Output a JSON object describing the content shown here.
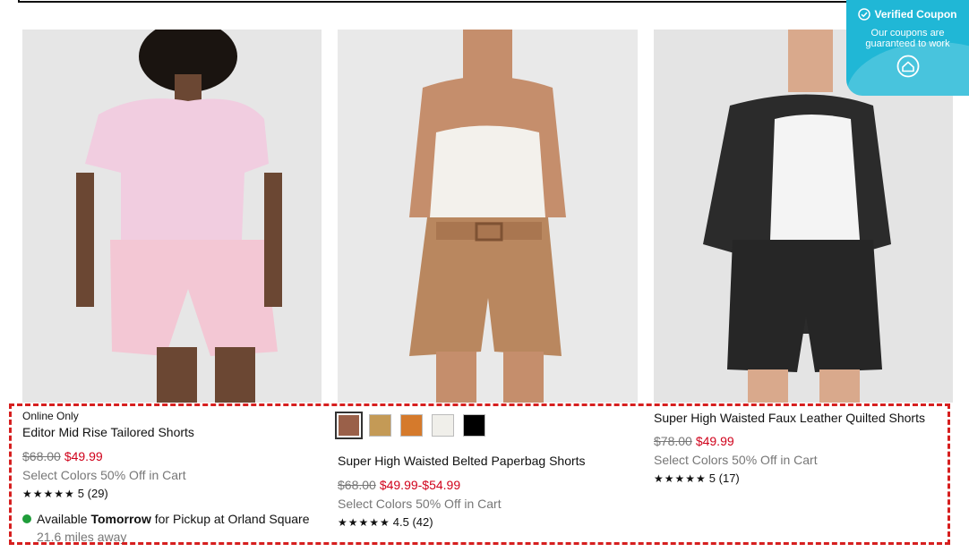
{
  "coupon": {
    "title": "Verified Coupon",
    "subtitle": "Our coupons are guaranteed to work"
  },
  "products": [
    {
      "eyebrow": "Online Only",
      "name": "Editor Mid Rise Tailored Shorts",
      "price_old": "$68.00",
      "price_new": "$49.99",
      "promo": "Select Colors 50% Off in Cart",
      "stars": "★★★★★",
      "rating_text": "5 (29)",
      "pickup": {
        "prefix": "Available",
        "day": "Tomorrow",
        "suffix": "for Pickup at Orland Square",
        "distance": "21.6 miles away"
      }
    },
    {
      "swatches": [
        "#9a6049",
        "#c49a56",
        "#d57a2c",
        "#f0efea",
        "#000000"
      ],
      "name": "Super High Waisted Belted Paperbag Shorts",
      "price_old": "$68.00",
      "price_new": "$49.99-$54.99",
      "promo": "Select Colors 50% Off in Cart",
      "stars": "★★★★★",
      "rating_text": "4.5 (42)"
    },
    {
      "name": "Super High Waisted Faux Leather Quilted Shorts",
      "price_old": "$78.00",
      "price_new": "$49.99",
      "promo": "Select Colors 50% Off in Cart",
      "stars": "★★★★★",
      "rating_text": "5 (17)"
    }
  ],
  "colors": {
    "sale_red": "#d0021b",
    "highlight_border": "#d61f1f",
    "coupon_bg": "#20b7d6",
    "pickup_green": "#1f9d3a"
  }
}
